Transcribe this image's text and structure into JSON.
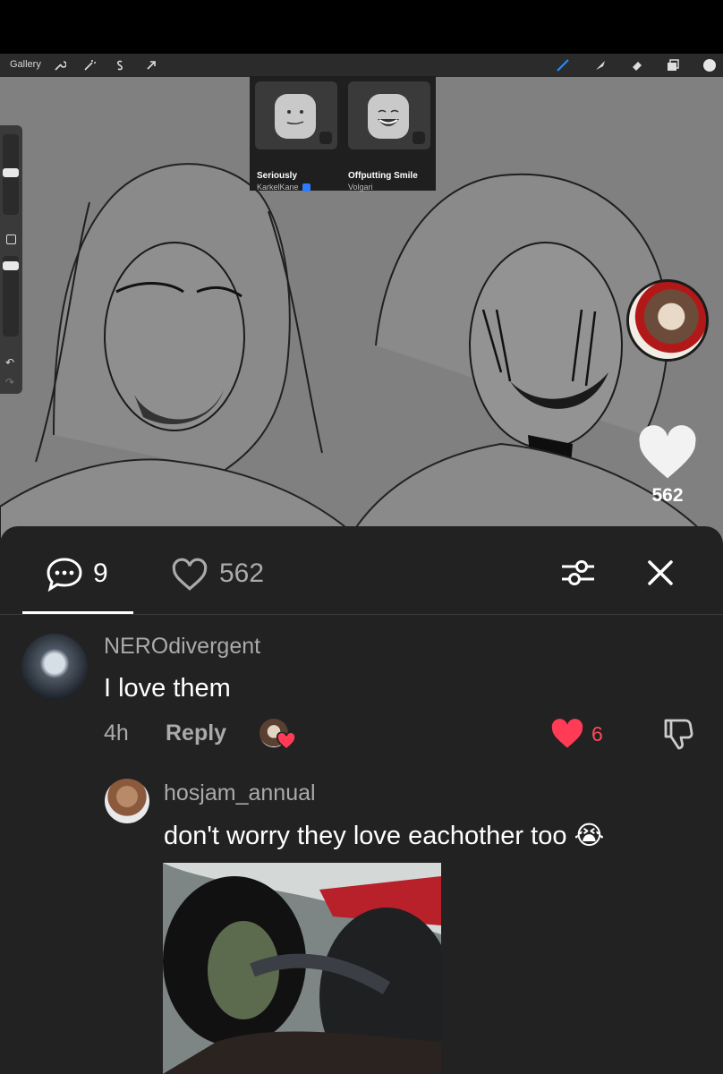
{
  "procreate": {
    "gallery_label": "Gallery",
    "toolbar_left_icons": [
      "wrench-icon",
      "magic-wand-icon",
      "selection-icon",
      "transform-arrow-icon"
    ],
    "toolbar_right_icons": [
      "brush-icon",
      "smudge-icon",
      "eraser-icon",
      "layers-icon",
      "color-swatch-icon"
    ]
  },
  "face_popup": {
    "items": [
      {
        "name": "Seriously",
        "creator": "KarkelKane"
      },
      {
        "name": "Offputting Smile",
        "creator": "Volgari"
      }
    ]
  },
  "video_overlay": {
    "like_count": "562"
  },
  "tabs": {
    "comment_count": "9",
    "like_count": "562"
  },
  "comments": [
    {
      "username": "NEROdivergent",
      "text": "I love them",
      "time": "4h",
      "reply_label": "Reply",
      "likes": "6"
    },
    {
      "username": "hosjam_annual",
      "text": "don't worry they love eachother too 😭"
    }
  ],
  "colors": {
    "panel_bg": "#222222",
    "like_red": "#ff4a5c",
    "muted_text": "#aaaaaa"
  }
}
